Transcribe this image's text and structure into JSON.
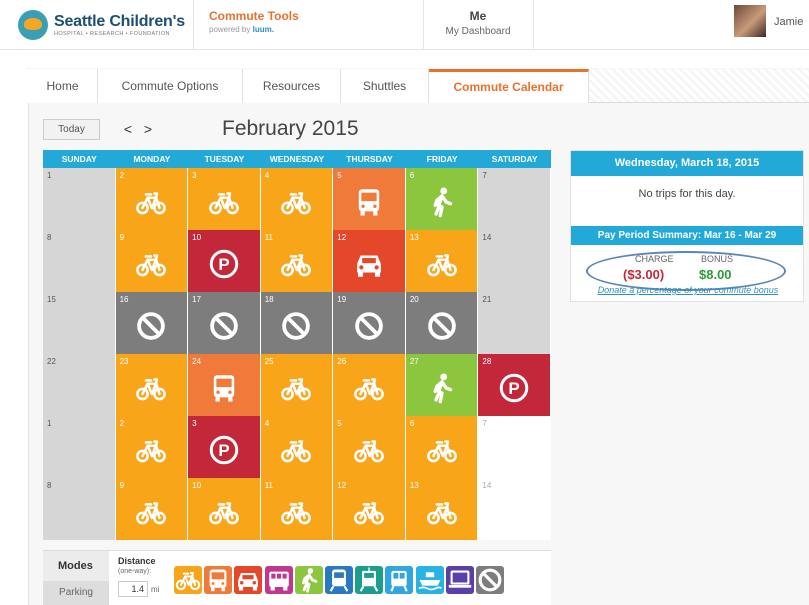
{
  "header": {
    "logo_name": "Seattle Children's",
    "logo_sub": "HOSPITAL • RESEARCH • FOUNDATION",
    "app_title": "Commute Tools",
    "powered_by": "powered by",
    "powered_brand": "luum.",
    "me_title": "Me",
    "me_sub": "My Dashboard",
    "user_name": "Jamie"
  },
  "tabs": [
    "Home",
    "Commute Options",
    "Resources",
    "Shuttles",
    "Commute Calendar"
  ],
  "active_tab": "Commute Calendar",
  "calendar": {
    "today_label": "Today",
    "prev": "<",
    "next": ">",
    "month": "February 2015",
    "days_of_week": [
      "SUNDAY",
      "MONDAY",
      "TUESDAY",
      "WEDNESDAY",
      "THURSDAY",
      "FRIDAY",
      "SATURDAY"
    ],
    "weeks": [
      [
        {
          "d": "1",
          "m": "none"
        },
        {
          "d": "2",
          "m": "bike"
        },
        {
          "d": "3",
          "m": "bike"
        },
        {
          "d": "4",
          "m": "bike"
        },
        {
          "d": "5",
          "m": "bus"
        },
        {
          "d": "6",
          "m": "walk"
        },
        {
          "d": "7",
          "m": "none"
        }
      ],
      [
        {
          "d": "8",
          "m": "none"
        },
        {
          "d": "9",
          "m": "bike"
        },
        {
          "d": "10",
          "m": "parking"
        },
        {
          "d": "11",
          "m": "bike"
        },
        {
          "d": "12",
          "m": "car"
        },
        {
          "d": "13",
          "m": "bike"
        },
        {
          "d": "14",
          "m": "none"
        }
      ],
      [
        {
          "d": "15",
          "m": "none"
        },
        {
          "d": "16",
          "m": "no"
        },
        {
          "d": "17",
          "m": "no"
        },
        {
          "d": "18",
          "m": "no"
        },
        {
          "d": "19",
          "m": "no"
        },
        {
          "d": "20",
          "m": "no"
        },
        {
          "d": "21",
          "m": "none"
        }
      ],
      [
        {
          "d": "22",
          "m": "none"
        },
        {
          "d": "23",
          "m": "bike"
        },
        {
          "d": "24",
          "m": "bus"
        },
        {
          "d": "25",
          "m": "bike"
        },
        {
          "d": "26",
          "m": "bike"
        },
        {
          "d": "27",
          "m": "walk"
        },
        {
          "d": "28",
          "m": "parking"
        }
      ],
      [
        {
          "d": "1",
          "m": "none"
        },
        {
          "d": "2",
          "m": "bike"
        },
        {
          "d": "3",
          "m": "parking"
        },
        {
          "d": "4",
          "m": "bike"
        },
        {
          "d": "5",
          "m": "bike"
        },
        {
          "d": "6",
          "m": "bike"
        },
        {
          "d": "7",
          "m": "white"
        }
      ],
      [
        {
          "d": "8",
          "m": "none"
        },
        {
          "d": "9",
          "m": "bike"
        },
        {
          "d": "10",
          "m": "bike"
        },
        {
          "d": "11",
          "m": "bike"
        },
        {
          "d": "12",
          "m": "bike"
        },
        {
          "d": "13",
          "m": "bike"
        },
        {
          "d": "14",
          "m": "white"
        }
      ]
    ]
  },
  "colors": {
    "bike": "#f9a51a",
    "bus": "#f07a3a",
    "car": "#e4472a",
    "walk": "#8cc63f",
    "parking": "#c3283a",
    "no": "#7d7d7d",
    "accent": "#e8722c",
    "header_blue": "#22a9d8"
  },
  "sidebar": {
    "date_title": "Wednesday, March 18, 2015",
    "no_trips": "No trips for this day.",
    "pay_period": "Pay Period Summary: Mar 16 - Mar 29",
    "charge_label": "CHARGE",
    "charge_value": "($3.00)",
    "bonus_label": "BONUS",
    "bonus_value": "$8.00",
    "donate_link": "Donate a percentage of your commute bonus"
  },
  "footer": {
    "modes_label": "Modes",
    "parking_label": "Parking",
    "distance_label": "Distance",
    "distance_sub": "(one-way):",
    "distance_value": "1.4",
    "distance_unit": "mi",
    "mode_icons": [
      "bike",
      "bus",
      "car",
      "vanpool",
      "walk",
      "train",
      "lightrail",
      "streetcar",
      "ferry",
      "telework",
      "no"
    ]
  },
  "mode_icon_colors": {
    "bike": "#f9a51a",
    "bus": "#f07a3a",
    "car": "#e4472a",
    "vanpool": "#c0388d",
    "walk": "#8cc63f",
    "train": "#2a78c2",
    "lightrail": "#1b9e8e",
    "streetcar": "#2fa6dd",
    "ferry": "#27b3e3",
    "telework": "#5a3fa8",
    "no": "#7d7d7d"
  }
}
